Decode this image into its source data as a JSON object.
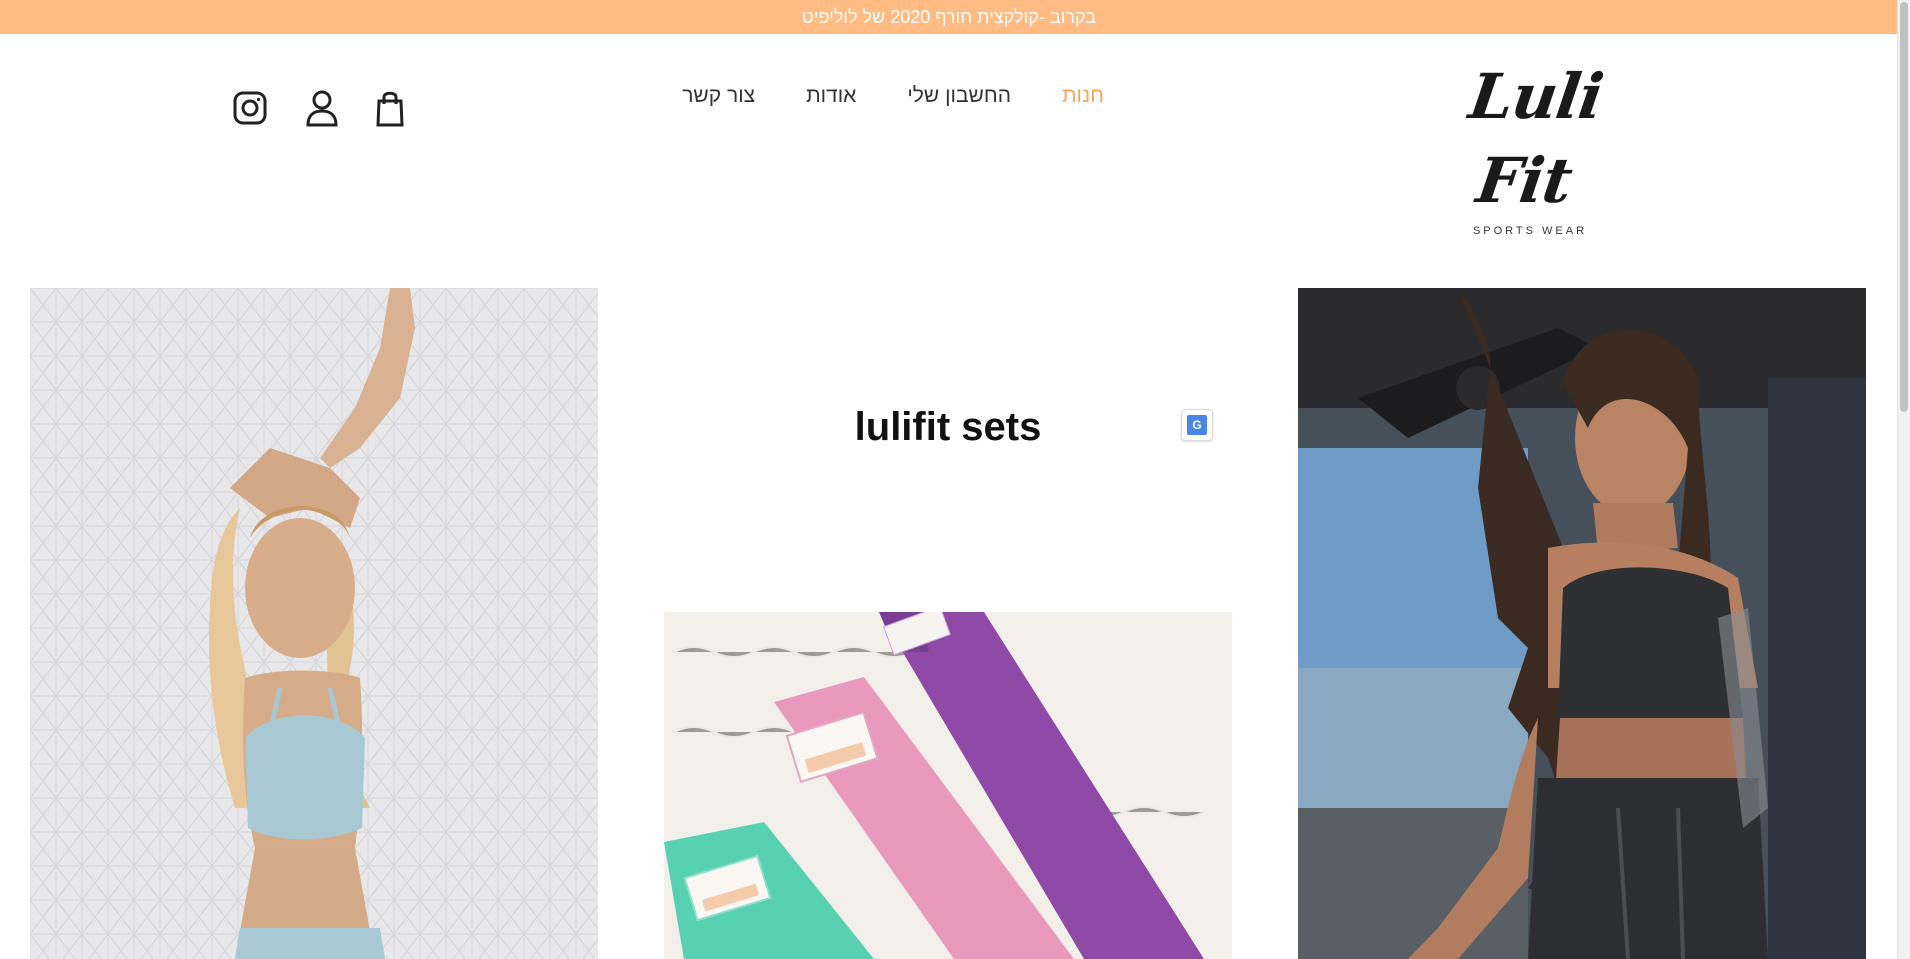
{
  "announcement": "בקרוב -קולקצית חורף 2020 של לוליפיט",
  "logo": {
    "script": "Luli Fit",
    "tagline": "SPORTS WEAR"
  },
  "nav": {
    "items": [
      {
        "label": "חנות",
        "active": true
      },
      {
        "label": "החשבון שלי",
        "active": false
      },
      {
        "label": "אודות",
        "active": false
      },
      {
        "label": "צור קשר",
        "active": false
      }
    ]
  },
  "header_icons": [
    "instagram-icon",
    "user-account-icon",
    "shopping-bag-icon"
  ],
  "main": {
    "title": "lulifit sets"
  },
  "colors": {
    "announcement_bg": "#FFBB82",
    "accent": "#F5A35A",
    "text": "#333333"
  }
}
